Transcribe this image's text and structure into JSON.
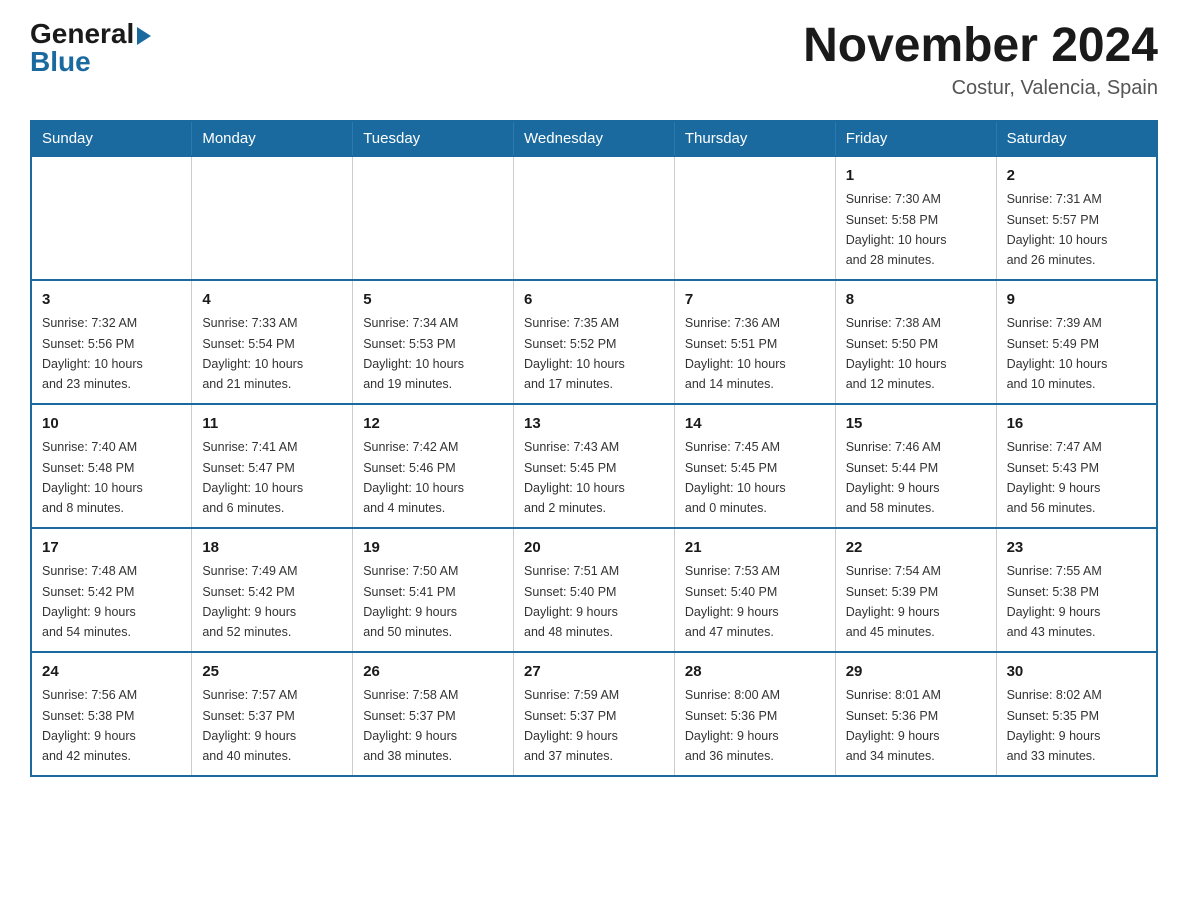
{
  "logo": {
    "general": "General",
    "blue": "Blue",
    "arrow": "▶"
  },
  "header": {
    "month_title": "November 2024",
    "location": "Costur, Valencia, Spain"
  },
  "weekdays": [
    "Sunday",
    "Monday",
    "Tuesday",
    "Wednesday",
    "Thursday",
    "Friday",
    "Saturday"
  ],
  "weeks": [
    [
      {
        "day": "",
        "info": ""
      },
      {
        "day": "",
        "info": ""
      },
      {
        "day": "",
        "info": ""
      },
      {
        "day": "",
        "info": ""
      },
      {
        "day": "",
        "info": ""
      },
      {
        "day": "1",
        "info": "Sunrise: 7:30 AM\nSunset: 5:58 PM\nDaylight: 10 hours\nand 28 minutes."
      },
      {
        "day": "2",
        "info": "Sunrise: 7:31 AM\nSunset: 5:57 PM\nDaylight: 10 hours\nand 26 minutes."
      }
    ],
    [
      {
        "day": "3",
        "info": "Sunrise: 7:32 AM\nSunset: 5:56 PM\nDaylight: 10 hours\nand 23 minutes."
      },
      {
        "day": "4",
        "info": "Sunrise: 7:33 AM\nSunset: 5:54 PM\nDaylight: 10 hours\nand 21 minutes."
      },
      {
        "day": "5",
        "info": "Sunrise: 7:34 AM\nSunset: 5:53 PM\nDaylight: 10 hours\nand 19 minutes."
      },
      {
        "day": "6",
        "info": "Sunrise: 7:35 AM\nSunset: 5:52 PM\nDaylight: 10 hours\nand 17 minutes."
      },
      {
        "day": "7",
        "info": "Sunrise: 7:36 AM\nSunset: 5:51 PM\nDaylight: 10 hours\nand 14 minutes."
      },
      {
        "day": "8",
        "info": "Sunrise: 7:38 AM\nSunset: 5:50 PM\nDaylight: 10 hours\nand 12 minutes."
      },
      {
        "day": "9",
        "info": "Sunrise: 7:39 AM\nSunset: 5:49 PM\nDaylight: 10 hours\nand 10 minutes."
      }
    ],
    [
      {
        "day": "10",
        "info": "Sunrise: 7:40 AM\nSunset: 5:48 PM\nDaylight: 10 hours\nand 8 minutes."
      },
      {
        "day": "11",
        "info": "Sunrise: 7:41 AM\nSunset: 5:47 PM\nDaylight: 10 hours\nand 6 minutes."
      },
      {
        "day": "12",
        "info": "Sunrise: 7:42 AM\nSunset: 5:46 PM\nDaylight: 10 hours\nand 4 minutes."
      },
      {
        "day": "13",
        "info": "Sunrise: 7:43 AM\nSunset: 5:45 PM\nDaylight: 10 hours\nand 2 minutes."
      },
      {
        "day": "14",
        "info": "Sunrise: 7:45 AM\nSunset: 5:45 PM\nDaylight: 10 hours\nand 0 minutes."
      },
      {
        "day": "15",
        "info": "Sunrise: 7:46 AM\nSunset: 5:44 PM\nDaylight: 9 hours\nand 58 minutes."
      },
      {
        "day": "16",
        "info": "Sunrise: 7:47 AM\nSunset: 5:43 PM\nDaylight: 9 hours\nand 56 minutes."
      }
    ],
    [
      {
        "day": "17",
        "info": "Sunrise: 7:48 AM\nSunset: 5:42 PM\nDaylight: 9 hours\nand 54 minutes."
      },
      {
        "day": "18",
        "info": "Sunrise: 7:49 AM\nSunset: 5:42 PM\nDaylight: 9 hours\nand 52 minutes."
      },
      {
        "day": "19",
        "info": "Sunrise: 7:50 AM\nSunset: 5:41 PM\nDaylight: 9 hours\nand 50 minutes."
      },
      {
        "day": "20",
        "info": "Sunrise: 7:51 AM\nSunset: 5:40 PM\nDaylight: 9 hours\nand 48 minutes."
      },
      {
        "day": "21",
        "info": "Sunrise: 7:53 AM\nSunset: 5:40 PM\nDaylight: 9 hours\nand 47 minutes."
      },
      {
        "day": "22",
        "info": "Sunrise: 7:54 AM\nSunset: 5:39 PM\nDaylight: 9 hours\nand 45 minutes."
      },
      {
        "day": "23",
        "info": "Sunrise: 7:55 AM\nSunset: 5:38 PM\nDaylight: 9 hours\nand 43 minutes."
      }
    ],
    [
      {
        "day": "24",
        "info": "Sunrise: 7:56 AM\nSunset: 5:38 PM\nDaylight: 9 hours\nand 42 minutes."
      },
      {
        "day": "25",
        "info": "Sunrise: 7:57 AM\nSunset: 5:37 PM\nDaylight: 9 hours\nand 40 minutes."
      },
      {
        "day": "26",
        "info": "Sunrise: 7:58 AM\nSunset: 5:37 PM\nDaylight: 9 hours\nand 38 minutes."
      },
      {
        "day": "27",
        "info": "Sunrise: 7:59 AM\nSunset: 5:37 PM\nDaylight: 9 hours\nand 37 minutes."
      },
      {
        "day": "28",
        "info": "Sunrise: 8:00 AM\nSunset: 5:36 PM\nDaylight: 9 hours\nand 36 minutes."
      },
      {
        "day": "29",
        "info": "Sunrise: 8:01 AM\nSunset: 5:36 PM\nDaylight: 9 hours\nand 34 minutes."
      },
      {
        "day": "30",
        "info": "Sunrise: 8:02 AM\nSunset: 5:35 PM\nDaylight: 9 hours\nand 33 minutes."
      }
    ]
  ]
}
